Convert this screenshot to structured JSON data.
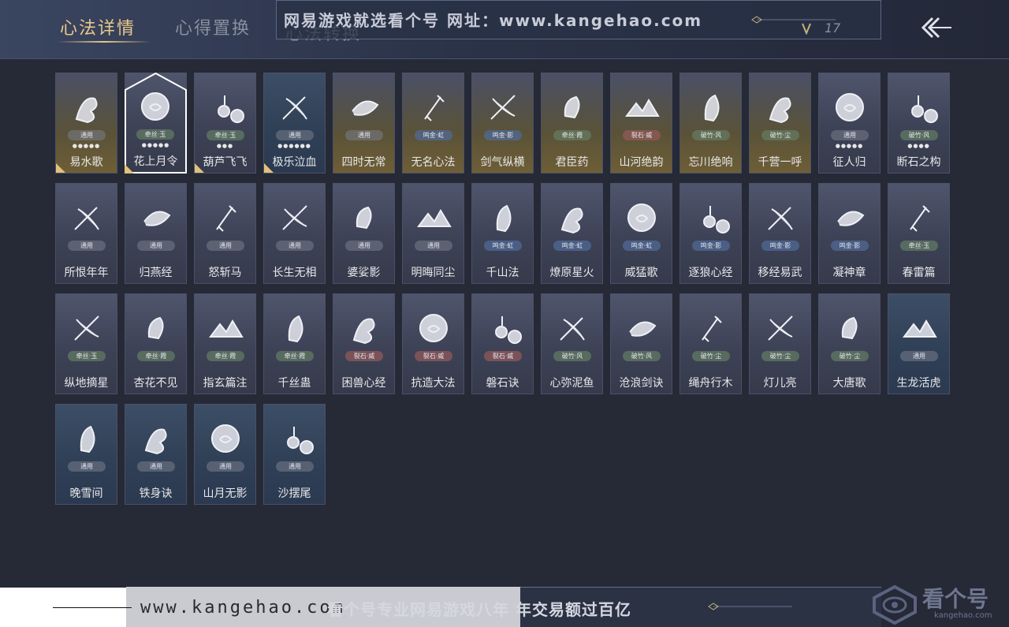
{
  "header": {
    "tabs": [
      {
        "label": "心法详情",
        "active": true
      },
      {
        "label": "心得置换",
        "active": false
      },
      {
        "label": "心法转换",
        "active": false
      }
    ],
    "count": "17"
  },
  "watermark": {
    "top": "网易游戏就选看个号   网址：www.kangehao.com",
    "bottom_site": "www.kangehao.com",
    "bottom_slogan": "看个号专业网易游戏八年  年交易额过百亿",
    "logo_text": "看个号",
    "logo_sub": "kangehao.com"
  },
  "cards": [
    {
      "name": "易水歌",
      "badge": "通用",
      "dots": "●●●●●",
      "style": "gold",
      "checked": true
    },
    {
      "name": "花上月令",
      "badge": "牵丝·玉",
      "dots": "●●●●●",
      "style": "normal",
      "checked": true,
      "selected": true
    },
    {
      "name": "葫芦飞飞",
      "badge": "牵丝·玉",
      "dots": "●●●",
      "style": "normal",
      "checked": true
    },
    {
      "name": "极乐泣血",
      "badge": "通用",
      "dots": "●●●●●●",
      "style": "blue",
      "checked": true
    },
    {
      "name": "四时无常",
      "badge": "通用",
      "dots": "",
      "style": "gold"
    },
    {
      "name": "无名心法",
      "badge": "鸣金·虹",
      "dots": "",
      "style": "gold"
    },
    {
      "name": "剑气纵横",
      "badge": "鸣金·影",
      "dots": "",
      "style": "gold"
    },
    {
      "name": "君臣药",
      "badge": "牵丝·霞",
      "dots": "",
      "style": "gold"
    },
    {
      "name": "山河绝韵",
      "badge": "裂石·威",
      "dots": "",
      "style": "gold"
    },
    {
      "name": "忘川绝响",
      "badge": "破竹·风",
      "dots": "",
      "style": "gold"
    },
    {
      "name": "千营一呼",
      "badge": "破竹·尘",
      "dots": "",
      "style": "gold"
    },
    {
      "name": "征人归",
      "badge": "通用",
      "dots": "●●●●●",
      "style": "normal"
    },
    {
      "name": "断石之构",
      "badge": "破竹·风",
      "dots": "●●●●",
      "style": "normal"
    },
    {
      "name": "所恨年年",
      "badge": "通用",
      "dots": "",
      "style": "normal"
    },
    {
      "name": "归燕经",
      "badge": "通用",
      "dots": "",
      "style": "normal"
    },
    {
      "name": "怒斩马",
      "badge": "通用",
      "dots": "",
      "style": "normal"
    },
    {
      "name": "长生无相",
      "badge": "通用",
      "dots": "",
      "style": "normal"
    },
    {
      "name": "婆娑影",
      "badge": "通用",
      "dots": "",
      "style": "normal"
    },
    {
      "name": "明晦同尘",
      "badge": "通用",
      "dots": "",
      "style": "normal"
    },
    {
      "name": "千山法",
      "badge": "鸣金·虹",
      "dots": "",
      "style": "normal"
    },
    {
      "name": "燎原星火",
      "badge": "鸣金·虹",
      "dots": "",
      "style": "normal"
    },
    {
      "name": "威猛歌",
      "badge": "鸣金·虹",
      "dots": "",
      "style": "normal"
    },
    {
      "name": "逐狼心经",
      "badge": "鸣金·影",
      "dots": "",
      "style": "normal"
    },
    {
      "name": "移经易武",
      "badge": "鸣金·影",
      "dots": "",
      "style": "normal"
    },
    {
      "name": "凝神章",
      "badge": "鸣金·影",
      "dots": "",
      "style": "normal"
    },
    {
      "name": "春雷篇",
      "badge": "牵丝·玉",
      "dots": "",
      "style": "normal"
    },
    {
      "name": "纵地摘星",
      "badge": "牵丝·玉",
      "dots": "",
      "style": "normal"
    },
    {
      "name": "杏花不见",
      "badge": "牵丝·霞",
      "dots": "",
      "style": "normal"
    },
    {
      "name": "指玄篇注",
      "badge": "牵丝·霞",
      "dots": "",
      "style": "normal"
    },
    {
      "name": "千丝蛊",
      "badge": "牵丝·霞",
      "dots": "",
      "style": "normal"
    },
    {
      "name": "困兽心经",
      "badge": "裂石·威",
      "dots": "",
      "style": "normal"
    },
    {
      "name": "抗造大法",
      "badge": "裂石·威",
      "dots": "",
      "style": "normal"
    },
    {
      "name": "磐石诀",
      "badge": "裂石·威",
      "dots": "",
      "style": "normal"
    },
    {
      "name": "心弥泥鱼",
      "badge": "破竹·风",
      "dots": "",
      "style": "normal"
    },
    {
      "name": "沧浪剑诀",
      "badge": "破竹·风",
      "dots": "",
      "style": "normal"
    },
    {
      "name": "绳舟行木",
      "badge": "破竹·尘",
      "dots": "",
      "style": "normal"
    },
    {
      "name": "灯儿亮",
      "badge": "破竹·尘",
      "dots": "",
      "style": "normal"
    },
    {
      "name": "大唐歌",
      "badge": "破竹·尘",
      "dots": "",
      "style": "normal"
    },
    {
      "name": "生龙活虎",
      "badge": "通用",
      "dots": "",
      "style": "blue"
    },
    {
      "name": "晚雪间",
      "badge": "通用",
      "dots": "",
      "style": "blue"
    },
    {
      "name": "铁身诀",
      "badge": "通用",
      "dots": "",
      "style": "blue"
    },
    {
      "name": "山月无影",
      "badge": "通用",
      "dots": "",
      "style": "blue"
    },
    {
      "name": "沙摆尾",
      "badge": "通用",
      "dots": "",
      "style": "blue"
    }
  ]
}
